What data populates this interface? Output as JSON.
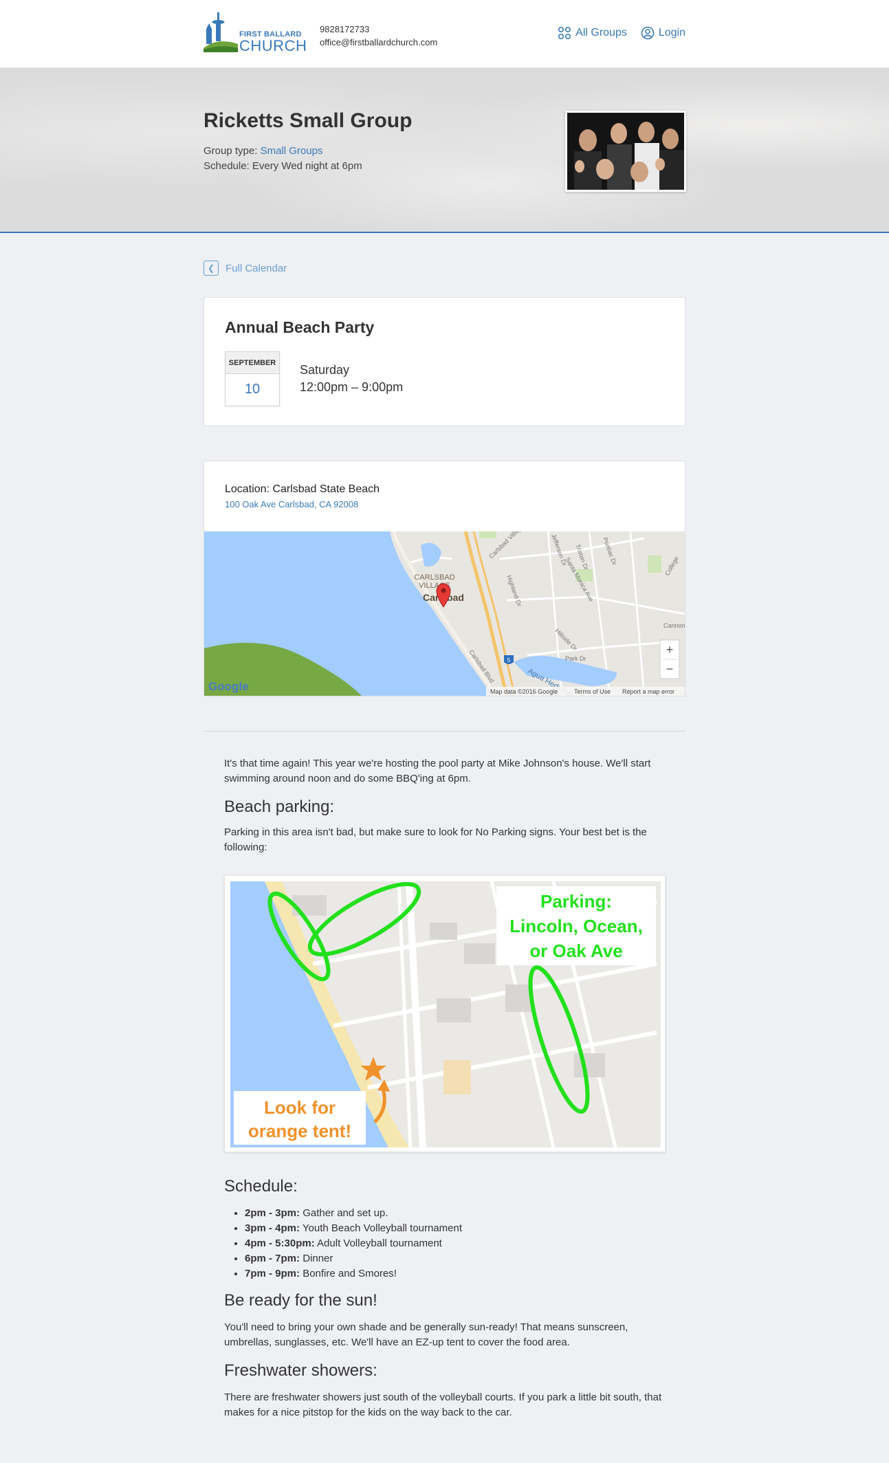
{
  "header": {
    "logo_line1": "FIRST BALLARD",
    "logo_line2": "CHURCH",
    "phone": "9828172733",
    "email": "office@firstballardchurch.com",
    "nav": [
      {
        "label": "All Groups",
        "icon": "groups-icon"
      },
      {
        "label": "Login",
        "icon": "user-icon"
      }
    ]
  },
  "group": {
    "title": "Ricketts Small Group",
    "type_label": "Group type:",
    "type_value": "Small Groups",
    "schedule": "Schedule: Every Wed night at 6pm"
  },
  "back_link": "Full Calendar",
  "event": {
    "title": "Annual Beach Party",
    "month": "SEPTEMBER",
    "day": "10",
    "weekday": "Saturday",
    "time": "12:00pm – 9:00pm"
  },
  "location": {
    "label": "Location: Carlsbad State Beach",
    "address": "100 Oak Ave Carlsbad, CA 92008",
    "map": {
      "place_label_1": "CARLSBAD",
      "place_label_2": "VILLAGE",
      "city_label": "Carlsbad",
      "water_label": "Agua Hedionda",
      "freeway_label": "5",
      "zoom_in": "+",
      "zoom_out": "−",
      "google": "Google",
      "attribution": "Map data ©2016 Google",
      "terms": "Terms of Use",
      "report": "Report a map error",
      "streets": [
        "Carlsbad Village Dr",
        "Highland Dr",
        "Park Dr",
        "Hillside Dr",
        "Carlsbad Blvd",
        "Pontiac Dr",
        "Santa Monica Ave",
        "Tristan Dr",
        "Jefferson Dr",
        "Cannon",
        "College"
      ]
    }
  },
  "content": {
    "intro": "It's that time again! This year we're hosting the pool party at Mike Johnson's house. We'll start swimming around noon and do some BBQ'ing at 6pm.",
    "parking_heading": "Beach parking:",
    "parking_text": "Parking in this area isn't bad, but make sure to look for No Parking signs. Your best bet is the following:",
    "parking_image": {
      "callout_1": "Parking:",
      "callout_2": "Lincoln, Ocean,",
      "callout_3": "or Oak Ave",
      "tent_1": "Look for",
      "tent_2": "orange tent!"
    },
    "schedule_heading": "Schedule:",
    "schedule": [
      {
        "time": "2pm - 3pm:",
        "desc": "Gather and set up."
      },
      {
        "time": "3pm - 4pm:",
        "desc": "Youth Beach Volleyball tournament"
      },
      {
        "time": "4pm - 5:30pm:",
        "desc": "Adult Volleyball tournament"
      },
      {
        "time": "6pm - 7pm:",
        "desc": "Dinner"
      },
      {
        "time": "7pm - 9pm:",
        "desc": "Bonfire and Smores!"
      }
    ],
    "sun_heading": "Be ready for the sun!",
    "sun_text": "You'll need to bring your own shade and be generally sun-ready! That means sunscreen, umbrellas, sunglasses, etc. We'll have an EZ-up tent to cover the food area.",
    "shower_heading": "Freshwater showers:",
    "shower_text": "There are freshwater showers just south of the volleyball courts. If you park a little bit south, that makes for a nice pitstop for the kids on the way back to the car."
  },
  "colors": {
    "accent": "#3a79b9",
    "parking_green": "#22e01c",
    "tent_orange": "#f0922b",
    "water": "#a3ccff"
  }
}
